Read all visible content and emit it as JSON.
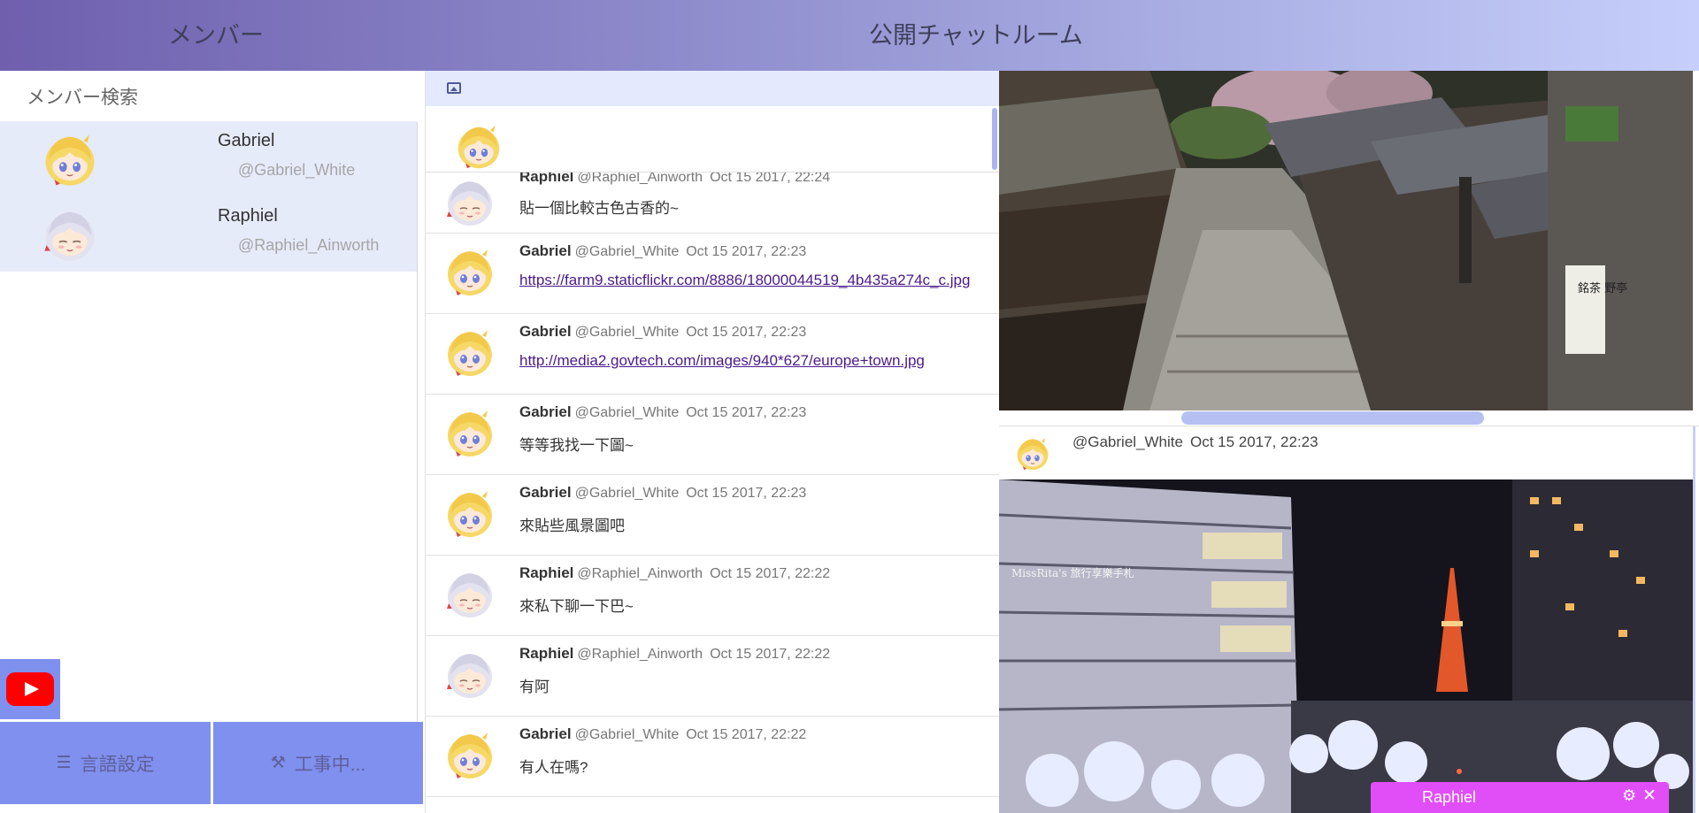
{
  "header": {
    "members_title": "メンバー",
    "room_title": "公開チャットルーム"
  },
  "sidebar": {
    "search_placeholder": "メンバー検索",
    "members": [
      {
        "name": "Gabriel",
        "handle": "@Gabriel_White",
        "avatar": "blonde-avatar"
      },
      {
        "name": "Raphiel",
        "handle": "@Raphiel_Ainworth",
        "avatar": "silver-avatar"
      }
    ],
    "youtube_icon": "youtube-icon",
    "language_button": {
      "label": "言語設定",
      "icon": "list-icon"
    },
    "wip_button": {
      "label": "工事中...",
      "icon": "hammer-icon"
    }
  },
  "chat": {
    "toolbar_icon": "image-upload-icon",
    "messages": [
      {
        "author": "Raphiel",
        "handle": "@Raphiel_Ainworth",
        "time": "Oct 15 2017, 22:24",
        "text": "貼一個比較古色古香的~",
        "link": false,
        "avatar": "silver"
      },
      {
        "author": "Gabriel",
        "handle": "@Gabriel_White",
        "time": "Oct 15 2017, 22:23",
        "text": "https://farm9.staticflickr.com/8886/18000044519_4b435a274c_c.jpg",
        "link": true,
        "avatar": "blonde"
      },
      {
        "author": "Gabriel",
        "handle": "@Gabriel_White",
        "time": "Oct 15 2017, 22:23",
        "text": "http://media2.govtech.com/images/940*627/europe+town.jpg",
        "link": true,
        "avatar": "blonde"
      },
      {
        "author": "Gabriel",
        "handle": "@Gabriel_White",
        "time": "Oct 15 2017, 22:23",
        "text": "等等我找一下圖~",
        "link": false,
        "avatar": "blonde"
      },
      {
        "author": "Gabriel",
        "handle": "@Gabriel_White",
        "time": "Oct 15 2017, 22:23",
        "text": "來貼些風景圖吧",
        "link": false,
        "avatar": "blonde"
      },
      {
        "author": "Raphiel",
        "handle": "@Raphiel_Ainworth",
        "time": "Oct 15 2017, 22:22",
        "text": "來私下聊一下巴~",
        "link": false,
        "avatar": "silver"
      },
      {
        "author": "Raphiel",
        "handle": "@Raphiel_Ainworth",
        "time": "Oct 15 2017, 22:22",
        "text": "有阿",
        "link": false,
        "avatar": "silver"
      },
      {
        "author": "Gabriel",
        "handle": "@Gabriel_White",
        "time": "Oct 15 2017, 22:22",
        "text": "有人在嗎?",
        "link": false,
        "avatar": "blonde"
      }
    ]
  },
  "image_panel": {
    "post": {
      "handle": "@Gabriel_White",
      "time": "Oct 15 2017, 22:23"
    },
    "photo_text": "MissRita's 旅行享樂手札",
    "sign_text": "銘茶 野亭"
  },
  "float_tab": {
    "name": "Raphiel",
    "gear_icon": "gear-icon",
    "close_icon": "close-icon",
    "color": "#e14ef8"
  }
}
